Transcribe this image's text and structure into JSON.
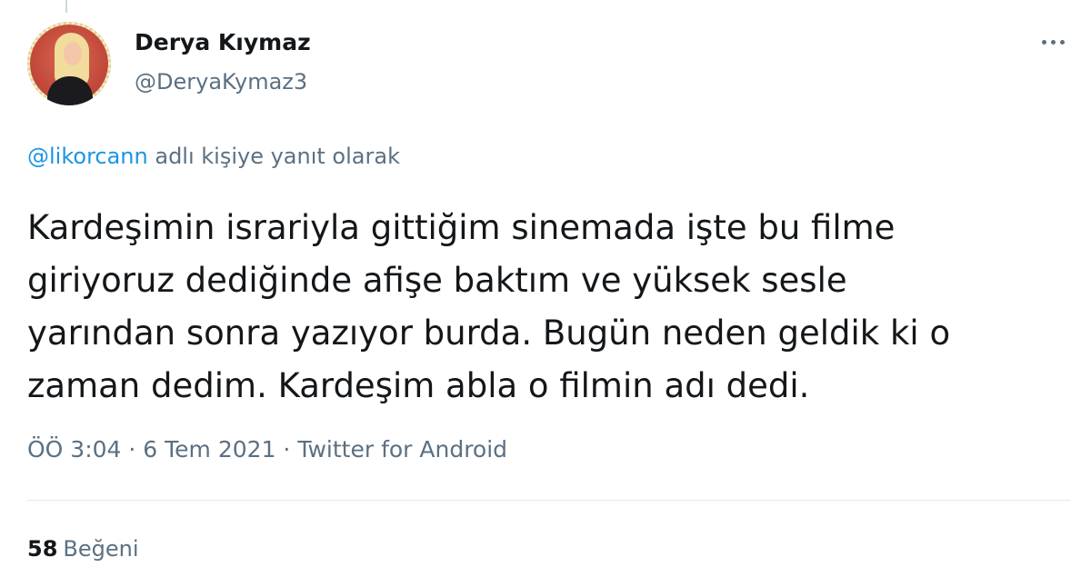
{
  "user": {
    "display_name": "Derya Kıymaz",
    "handle": "@DeryaKymaz3"
  },
  "reply_context": {
    "mention": "@likorcann",
    "suffix": " adlı kişiye yanıt olarak"
  },
  "tweet": {
    "lines": [
      "Kardeşimin israriyla gittiğim sinemada işte bu filme",
      "giriyoruz dediğinde afişe baktım ve yüksek sesle",
      "yarından sonra yazıyor burda. Bugün neden geldik ki o",
      "zaman dedim. Kardeşim abla o filmin adı dedi."
    ],
    "time": "ÖÖ 3:04",
    "separator": " · ",
    "date": "6 Tem 2021",
    "source": "Twitter for Android"
  },
  "stats": {
    "likes_count": "58",
    "likes_label": "Beğeni"
  },
  "icons": {
    "more": "more-horizontal-icon"
  },
  "colors": {
    "link": "#1b95e0",
    "secondary_text": "#5b7083",
    "primary_text": "#14171a",
    "divider": "#e1e8ed"
  }
}
